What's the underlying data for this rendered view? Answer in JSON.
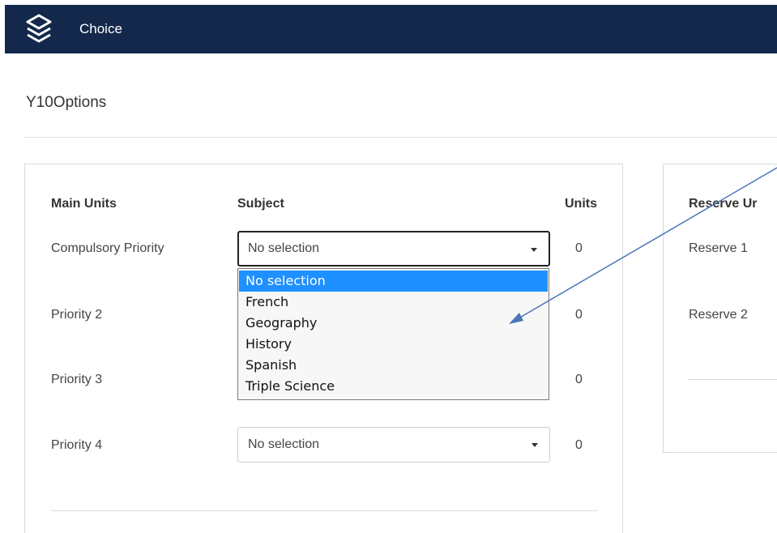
{
  "app": {
    "title": "Choice"
  },
  "page": {
    "title": "Y10Options"
  },
  "main": {
    "headers": {
      "units_col": "Main Units",
      "subject": "Subject",
      "units": "Units"
    },
    "rows": [
      {
        "label": "Compulsory Priority",
        "selected": "No selection",
        "units": "0"
      },
      {
        "label": "Priority 2",
        "units": "0"
      },
      {
        "label": "Priority 3",
        "units": "0"
      },
      {
        "label": "Priority 4",
        "selected": "No selection",
        "units": "0"
      }
    ]
  },
  "dropdown": {
    "options": [
      "No selection",
      "French",
      "Geography",
      "History",
      "Spanish",
      "Triple Science"
    ],
    "highlighted": "No selection"
  },
  "reserve": {
    "header": "Reserve Ur",
    "rows": [
      {
        "label": "Reserve 1"
      },
      {
        "label": "Reserve 2"
      }
    ]
  },
  "colors": {
    "topbar": "#13284b",
    "highlight": "#1e90ff",
    "annotation_arrow": "#4a76b8"
  },
  "icons": {
    "logo": "layers-icon",
    "caret": "caret-down-icon"
  }
}
